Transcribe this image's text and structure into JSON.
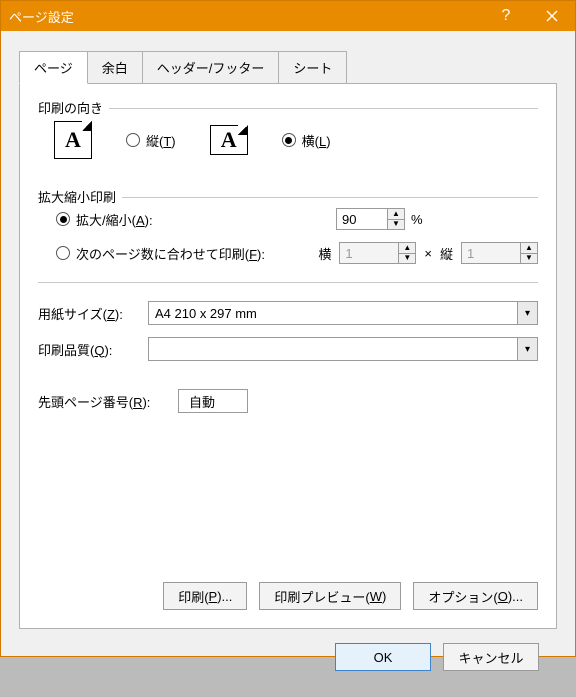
{
  "title": "ページ設定",
  "tabs": [
    "ページ",
    "余白",
    "ヘッダー/フッター",
    "シート"
  ],
  "orientation": {
    "group_label": "印刷の向き",
    "portrait": "縦(T)",
    "landscape": "横(L)"
  },
  "scaling": {
    "group_label": "拡大縮小印刷",
    "adjust": "拡大/縮小(A):",
    "adjust_value": "90",
    "percent": "%",
    "fit": "次のページ数に合わせて印刷(F):",
    "wide_label": "横",
    "wide_value": "1",
    "times": "×",
    "tall_label": "縦",
    "tall_value": "1"
  },
  "paper_size": {
    "label": "用紙サイズ(Z):",
    "value": "A4 210 x 297 mm"
  },
  "print_quality": {
    "label": "印刷品質(Q):",
    "value": ""
  },
  "first_page": {
    "label": "先頭ページ番号(R):",
    "value": "自動"
  },
  "buttons": {
    "print": "印刷(P)...",
    "preview": "印刷プレビュー(W)",
    "options": "オプション(O)...",
    "ok": "OK",
    "cancel": "キャンセル"
  }
}
